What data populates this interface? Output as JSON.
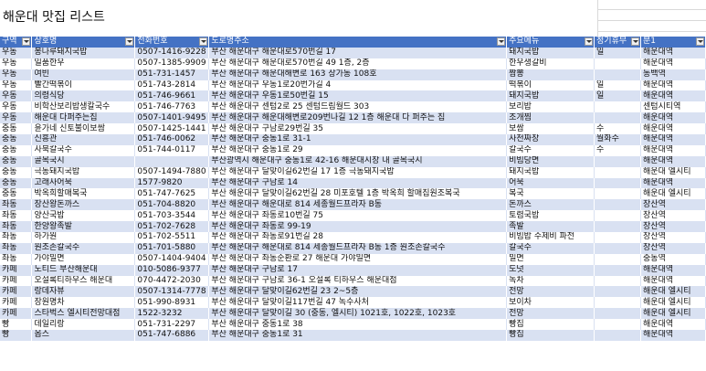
{
  "title": "해운대 맛집 리스트",
  "table": {
    "headers": [
      "구역",
      "상호명",
      "전화번호",
      "도로명주소",
      "주요메뉴",
      "정기휴무",
      "분1"
    ],
    "rows": [
      [
        "우동",
        "봉나루돼지국밥",
        "0507-1416-9228",
        "부산 해운대구 해운대로570번길 17",
        "돼지국밥",
        "일",
        "해운대역"
      ],
      [
        "우동",
        "일품한우",
        "0507-1385-9909",
        "부산 해운대구 해운대로570번길 49 1층, 2층",
        "한우생갈비",
        "",
        "해운대역"
      ],
      [
        "우동",
        "여빈",
        "051-731-1457",
        "부산 해운대구 해운대해변로 163 상가동 108호",
        "짬뽕",
        "",
        "동백역"
      ],
      [
        "우동",
        "빨간떡볶이",
        "051-743-2814",
        "부산 해운대구 우동1로20번가길 4",
        "떡볶이",
        "일",
        "해운대역"
      ],
      [
        "우동",
        "의령식당",
        "051-746-9661",
        "부산 해운대구 우동1로50번길 15",
        "돼지국밥",
        "일",
        "해운대역"
      ],
      [
        "우동",
        "비학산보리밥생칼국수",
        "051-746-7763",
        "부산 해운대구 센텀2로 25 센텀드림월드 303",
        "보리밥",
        "",
        "센텀시티역"
      ],
      [
        "우동",
        "해운대 다퍼주는집",
        "0507-1401-9495",
        "부산 해운대구 해운대해변로209번나길 12 1층 해운대 다 퍼주는 집",
        "조개찜",
        "",
        "해운대역"
      ],
      [
        "중동",
        "윤가네 신토불이보쌈",
        "0507-1425-1441",
        "부산 해운대구 구남로29번길 35",
        "보쌈",
        "수",
        "해운대역"
      ],
      [
        "중동",
        "신흥관",
        "051-746-0062",
        "부산 해운대구 중동1로 31-1",
        "사천짜장",
        "월화수",
        "해운대역"
      ],
      [
        "중동",
        "사북칼국수",
        "051-744-0117",
        "부산 해운대구 중동1로 29",
        "칼국수",
        "수",
        "해운대역"
      ],
      [
        "중동",
        "골목국시",
        "",
        "부산광역시 해운대구 중동1로 42-16 해운대시장 내 골목국시",
        "비빔당면",
        "",
        "해운대역"
      ],
      [
        "중동",
        "극동돼지국밥",
        "0507-1494-7880",
        "부산 해운대구 달맞이길62번길 17 1층 극동돼지국밥",
        "돼지국밥",
        "",
        "해운대 엘시티"
      ],
      [
        "중동",
        "고래사어묵",
        "1577-9820",
        "부산 해운대구 구남로 14",
        "어묵",
        "",
        "해운대역"
      ],
      [
        "중동",
        "박옥희할매복국",
        "051-747-7625",
        "부산 해운대구 달맞이길62번길 28 미포호텔 1층 박옥희 할매집원조복국",
        "복국",
        "",
        "해운대 엘시티"
      ],
      [
        "좌동",
        "장산왕돈까스",
        "051-704-8820",
        "부산 해운대구 해운대로 814 세종월드프라자 B동",
        "돈까스",
        "",
        "장산역"
      ],
      [
        "좌동",
        "양산국밥",
        "051-703-3544",
        "부산 해운대구 좌동로10번길 75",
        "토렴국밥",
        "",
        "장산역"
      ],
      [
        "좌동",
        "한양왕족발",
        "051-702-7628",
        "부산 해운대구 좌동로 99-19",
        "족발",
        "",
        "장산역"
      ],
      [
        "좌동",
        "하가원",
        "051-702-5511",
        "부산 해운대구 좌동로91번길 28",
        "비빔밥 수제비 파전",
        "",
        "장산역"
      ],
      [
        "좌동",
        "원조손칼국수",
        "051-701-5880",
        "부산 해운대구 해운대로 814 세종월드프라자 B동 1층 원조손칼국수",
        "칼국수",
        "",
        "장산역"
      ],
      [
        "좌동",
        "가야밀면",
        "0507-1404-9404",
        "부산 해운대구 좌동순환로 27 해운대 가야밀면",
        "밀면",
        "",
        "중동역"
      ],
      [
        "카페",
        "노티드 부산해운대",
        "010-5086-9377",
        "부산 해운대구 구남로 17",
        "도넛",
        "",
        "해운대역"
      ],
      [
        "카페",
        "오설록티하우스 해운대",
        "070-4472-2030",
        "부산 해운대구 구남로 36-1 오설록 티하우스 해운대점",
        "녹차",
        "",
        "해운대역"
      ],
      [
        "카페",
        "랑데자뷰",
        "0507-1314-7778",
        "부산 해운대구 달맞이길62번길 23 2~5층",
        "전망",
        "",
        "해운대 엘시티"
      ],
      [
        "카페",
        "장원명차",
        "051-990-8931",
        "부산 해운대구 달맞이길117번길 47 녹수사처",
        "보이차",
        "",
        "해운대 엘시티"
      ],
      [
        "카페",
        "스타벅스 엘시티전망대점",
        "1522-3232",
        "부산 해운대구 달맞이길 30 (중동, 엘시티) 1021호, 1022호, 1023호",
        "전망",
        "",
        "해운대 엘시티"
      ],
      [
        "빵",
        "데일리랑",
        "051-731-2297",
        "부산 해운대구 중동1로 38",
        "빵집",
        "",
        "해운대역"
      ],
      [
        "빵",
        "옵스",
        "051-747-6886",
        "부산 해운대구 중동1로 31",
        "빵집",
        "",
        "해운대역"
      ]
    ]
  }
}
